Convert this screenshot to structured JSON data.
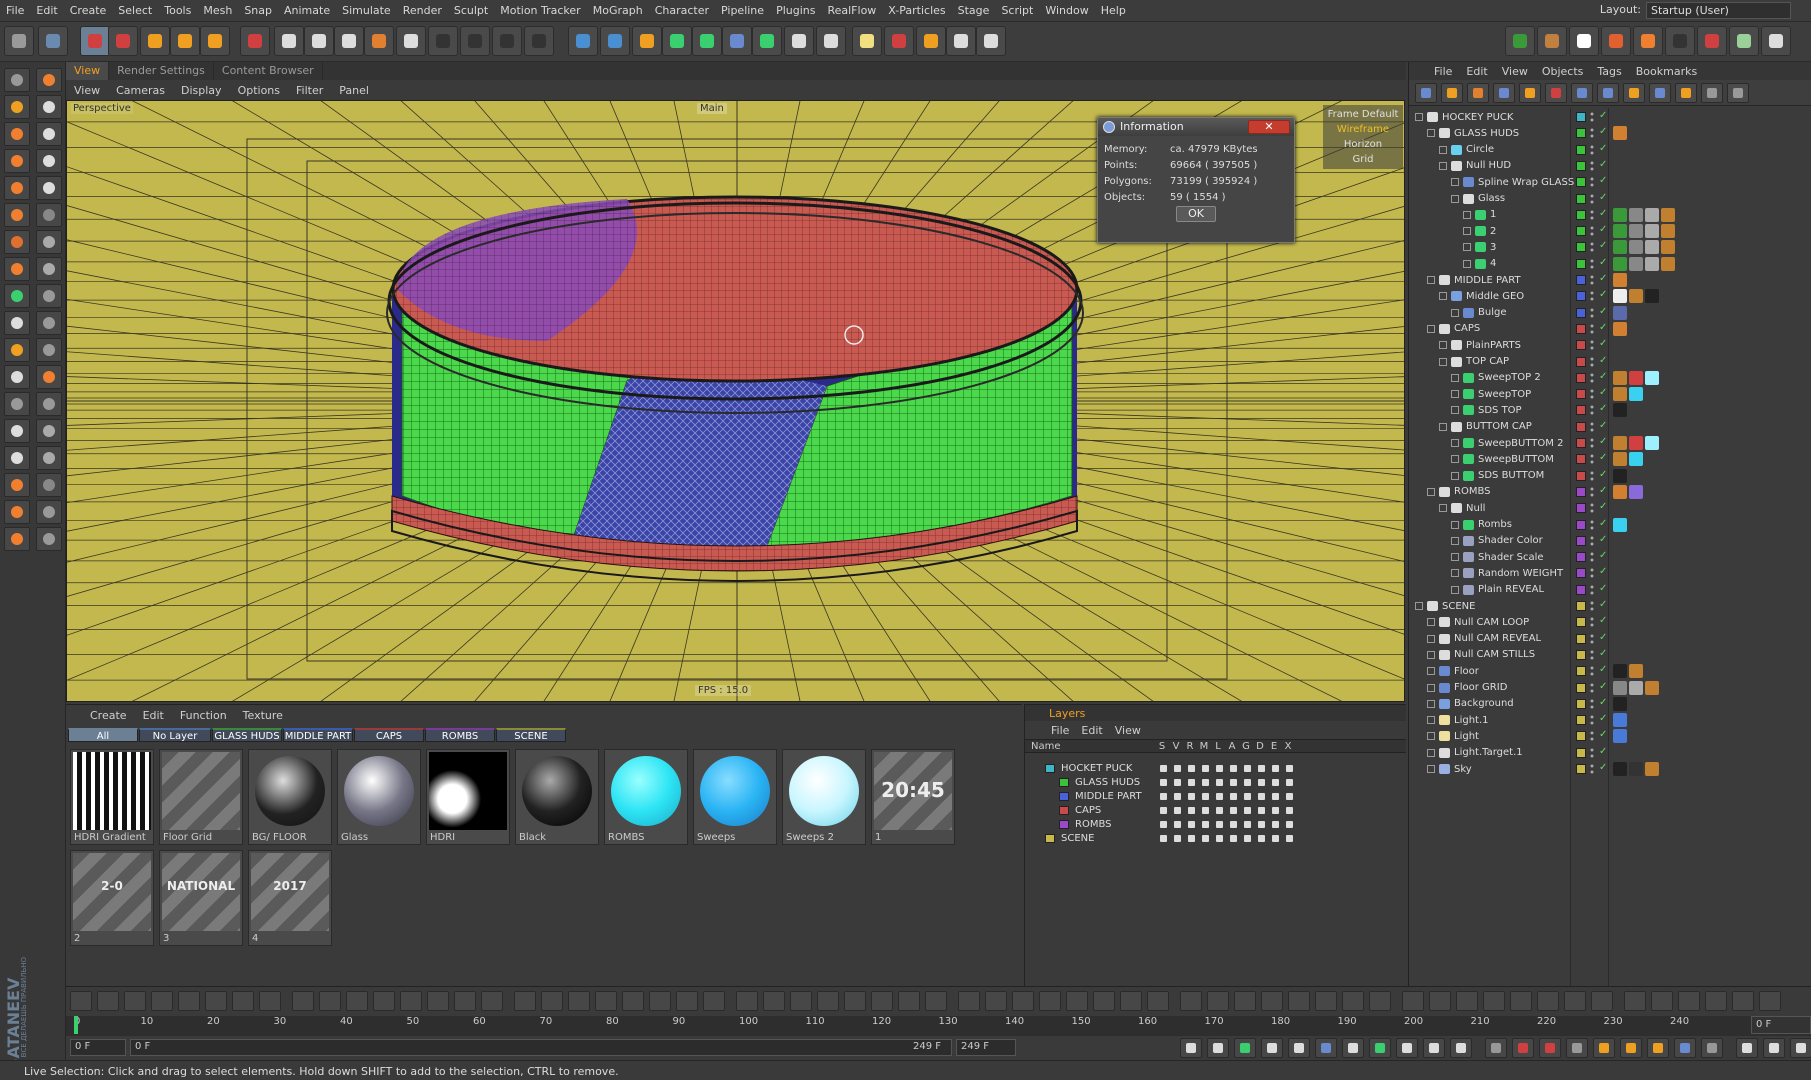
{
  "menubar": {
    "items": [
      "File",
      "Edit",
      "Create",
      "Select",
      "Tools",
      "Mesh",
      "Snap",
      "Animate",
      "Simulate",
      "Render",
      "Sculpt",
      "Motion Tracker",
      "MoGraph",
      "Character",
      "Pipeline",
      "Plugins",
      "RealFlow",
      "X-Particles",
      "Stage",
      "Script",
      "Window",
      "Help"
    ],
    "layout_label": "Layout:",
    "layout_value": "Startup (User)"
  },
  "viewport_tabs": [
    "View",
    "Render Settings",
    "Content Browser"
  ],
  "viewport_menu": [
    "View",
    "Cameras",
    "Display",
    "Options",
    "Filter",
    "Panel"
  ],
  "viewport": {
    "camera_label": "Perspective",
    "main_label": "Main",
    "display_modes": [
      "Frame Default",
      "Wireframe",
      "Horizon",
      "Grid"
    ],
    "fps": "FPS : 15.0"
  },
  "info_dialog": {
    "title": "Information",
    "rows": [
      {
        "key": "Memory:",
        "value": "ca. 47979 KBytes"
      },
      {
        "key": "Points:",
        "value": "69664 ( 397505 )"
      },
      {
        "key": "Polygons:",
        "value": "73199 ( 395924 )"
      },
      {
        "key": "Objects:",
        "value": "59 ( 1554 )"
      }
    ],
    "ok_label": "OK"
  },
  "materials": {
    "menu": [
      "Create",
      "Edit",
      "Function",
      "Texture"
    ],
    "tabs": [
      {
        "label": "All",
        "color": "#6b7f95"
      },
      {
        "label": "No Layer",
        "color": "#4a6a9a"
      },
      {
        "label": "GLASS HUDS",
        "color": "#3a8a3a"
      },
      {
        "label": "MIDDLE PART",
        "color": "#3a5aaa"
      },
      {
        "label": "CAPS",
        "color": "#9a3a3a"
      },
      {
        "label": "ROMBS",
        "color": "#7a3a9a"
      },
      {
        "label": "SCENE",
        "color": "#8a8a3a"
      }
    ],
    "tiles": [
      "HDRI Gradient",
      "Floor Grid",
      "BG/ FLOOR",
      "Glass",
      "HDRI",
      "Black",
      "ROMBS",
      "Sweeps",
      "Sweeps 2",
      "1",
      "2",
      "3",
      "4"
    ],
    "tile_texts": {
      "t1": "20:45",
      "t2": "2-0",
      "t3": "NATIONAL",
      "t4": "2017"
    }
  },
  "layers": {
    "title": "Layers",
    "menu": [
      "File",
      "Edit",
      "View"
    ],
    "columns": [
      "Name",
      "S",
      "V",
      "R",
      "M",
      "L",
      "A",
      "G",
      "D",
      "E",
      "X"
    ],
    "rows": [
      {
        "name": "HOCKET PUCK",
        "color": "#3fb6c6"
      },
      {
        "name": "GLASS HUDS",
        "color": "#3bc43b"
      },
      {
        "name": "MIDDLE PART",
        "color": "#4a62d8"
      },
      {
        "name": "CAPS",
        "color": "#c84a4a"
      },
      {
        "name": "ROMBS",
        "color": "#9a4ac8"
      },
      {
        "name": "SCENE",
        "color": "#c8b84a"
      }
    ]
  },
  "objects": {
    "menu": [
      "File",
      "Edit",
      "View",
      "Objects",
      "Tags",
      "Bookmarks"
    ],
    "tree": [
      {
        "name": "HOCKEY PUCK",
        "depth": 0,
        "layer": "#3fb6c6",
        "icon": "null",
        "tags": []
      },
      {
        "name": "GLASS HUDS",
        "depth": 1,
        "layer": "#3bc43b",
        "icon": "null",
        "tags": [
          "#d08030"
        ]
      },
      {
        "name": "Circle",
        "depth": 2,
        "layer": "#3bc43b",
        "icon": "spline",
        "tags": []
      },
      {
        "name": "Null HUD",
        "depth": 2,
        "layer": "#3bc43b",
        "icon": "null",
        "tags": []
      },
      {
        "name": "Spline Wrap GLASS",
        "depth": 3,
        "layer": "#3bc43b",
        "icon": "deformer",
        "tags": []
      },
      {
        "name": "Glass",
        "depth": 3,
        "layer": "#3bc43b",
        "icon": "null",
        "tags": []
      },
      {
        "name": "1",
        "depth": 4,
        "layer": "#3bc43b",
        "icon": "cloner",
        "tags": [
          "#3a9a3a",
          "#888",
          "#aaa",
          "#c08030"
        ]
      },
      {
        "name": "2",
        "depth": 4,
        "layer": "#3bc43b",
        "icon": "cloner",
        "tags": [
          "#3a9a3a",
          "#888",
          "#aaa",
          "#c08030"
        ]
      },
      {
        "name": "3",
        "depth": 4,
        "layer": "#3bc43b",
        "icon": "cloner",
        "tags": [
          "#3a9a3a",
          "#888",
          "#aaa",
          "#c08030"
        ]
      },
      {
        "name": "4",
        "depth": 4,
        "layer": "#3bc43b",
        "icon": "cloner",
        "tags": [
          "#3a9a3a",
          "#888",
          "#aaa",
          "#c08030"
        ]
      },
      {
        "name": "MIDDLE PART",
        "depth": 1,
        "layer": "#4a62d8",
        "icon": "null",
        "tags": [
          "#d08030"
        ]
      },
      {
        "name": "Middle GEO",
        "depth": 2,
        "layer": "#4a62d8",
        "icon": "polygon",
        "tags": [
          "#eee",
          "#c08030",
          "#222"
        ]
      },
      {
        "name": "Bulge",
        "depth": 3,
        "layer": "#4a62d8",
        "icon": "deformer",
        "tags": [
          "#5a6aaa"
        ]
      },
      {
        "name": "CAPS",
        "depth": 1,
        "layer": "#c84a4a",
        "icon": "null",
        "tags": [
          "#d08030"
        ]
      },
      {
        "name": "PlainPARTS",
        "depth": 2,
        "layer": "#c84a4a",
        "icon": "null",
        "tags": []
      },
      {
        "name": "TOP CAP",
        "depth": 2,
        "layer": "#c84a4a",
        "icon": "null",
        "tags": []
      },
      {
        "name": "SweepTOP 2",
        "depth": 3,
        "layer": "#c84a4a",
        "icon": "sweep",
        "tags": [
          "#c08030",
          "#d04040",
          "#9ef0ff"
        ]
      },
      {
        "name": "SweepTOP",
        "depth": 3,
        "layer": "#c84a4a",
        "icon": "sweep",
        "tags": [
          "#c08030",
          "#3ad0f0"
        ]
      },
      {
        "name": "SDS TOP",
        "depth": 3,
        "layer": "#c84a4a",
        "icon": "sds",
        "tags": [
          "#222"
        ]
      },
      {
        "name": "BUTTOM CAP",
        "depth": 2,
        "layer": "#c84a4a",
        "icon": "null",
        "tags": []
      },
      {
        "name": "SweepBUTTOM 2",
        "depth": 3,
        "layer": "#c84a4a",
        "icon": "sweep",
        "tags": [
          "#c08030",
          "#d04040",
          "#9ef0ff"
        ]
      },
      {
        "name": "SweepBUTTOM",
        "depth": 3,
        "layer": "#c84a4a",
        "icon": "sweep",
        "tags": [
          "#c08030",
          "#3ad0f0"
        ]
      },
      {
        "name": "SDS BUTTOM",
        "depth": 3,
        "layer": "#c84a4a",
        "icon": "sds",
        "tags": [
          "#222"
        ]
      },
      {
        "name": "ROMBS",
        "depth": 1,
        "layer": "#9a4ac8",
        "icon": "null",
        "tags": [
          "#d08030",
          "#8a6ad8"
        ]
      },
      {
        "name": "Null",
        "depth": 2,
        "layer": "#9a4ac8",
        "icon": "null",
        "tags": []
      },
      {
        "name": "Rombs",
        "depth": 3,
        "layer": "#9a4ac8",
        "icon": "cloner",
        "tags": [
          "#3ad0f0"
        ]
      },
      {
        "name": "Shader Color",
        "depth": 3,
        "layer": "#9a4ac8",
        "icon": "effector",
        "tags": []
      },
      {
        "name": "Shader Scale",
        "depth": 3,
        "layer": "#9a4ac8",
        "icon": "effector",
        "tags": []
      },
      {
        "name": "Random WEIGHT",
        "depth": 3,
        "layer": "#9a4ac8",
        "icon": "effector",
        "tags": []
      },
      {
        "name": "Plain REVEAL",
        "depth": 3,
        "layer": "#9a4ac8",
        "icon": "effector",
        "tags": []
      },
      {
        "name": "SCENE",
        "depth": 0,
        "layer": "#c8b84a",
        "icon": "null",
        "tags": []
      },
      {
        "name": "Null CAM LOOP",
        "depth": 1,
        "layer": "#c8b84a",
        "icon": "null",
        "tags": []
      },
      {
        "name": "Null CAM REVEAL",
        "depth": 1,
        "layer": "#c8b84a",
        "icon": "null",
        "tags": []
      },
      {
        "name": "Null CAM STILLS",
        "depth": 1,
        "layer": "#c8b84a",
        "icon": "null",
        "tags": []
      },
      {
        "name": "Floor",
        "depth": 1,
        "layer": "#c8b84a",
        "icon": "floor",
        "tags": [
          "#222",
          "#c08030"
        ]
      },
      {
        "name": "Floor GRID",
        "depth": 1,
        "layer": "#c8b84a",
        "icon": "floor",
        "tags": [
          "#888",
          "#aaa",
          "#c08030"
        ]
      },
      {
        "name": "Background",
        "depth": 1,
        "layer": "#c8b84a",
        "icon": "bg",
        "tags": [
          "#222"
        ]
      },
      {
        "name": "Light.1",
        "depth": 1,
        "layer": "#c8b84a",
        "icon": "light",
        "tags": [
          "#4a7ad8"
        ]
      },
      {
        "name": "Light",
        "depth": 1,
        "layer": "#c8b84a",
        "icon": "light",
        "tags": [
          "#4a7ad8"
        ]
      },
      {
        "name": "Light.Target.1",
        "depth": 1,
        "layer": "#c8b84a",
        "icon": "null",
        "tags": []
      },
      {
        "name": "Sky",
        "depth": 1,
        "layer": "#c8b84a",
        "icon": "sky",
        "tags": [
          "#222",
          "#333",
          "#c08030"
        ]
      }
    ]
  },
  "timeline": {
    "ticks": [
      "0",
      "10",
      "20",
      "30",
      "40",
      "50",
      "60",
      "70",
      "80",
      "90",
      "100",
      "110",
      "120",
      "130",
      "140",
      "150",
      "160",
      "170",
      "180",
      "190",
      "200",
      "210",
      "220",
      "230",
      "240"
    ],
    "current_frame": "0 F",
    "start_field": "0 F",
    "range_start": "0 F",
    "range_end": "249 F",
    "end_field": "249 F",
    "right_field": "0 F"
  },
  "status_text": "Live Selection: Click and drag to select elements. Hold down SHIFT to add to the selection, CTRL to remove.",
  "watermark": "SATANEEV",
  "watermark_sub": "ТЫ ВСЕ ДЕЛАЕШЬ ПРАВИЛЬНО"
}
